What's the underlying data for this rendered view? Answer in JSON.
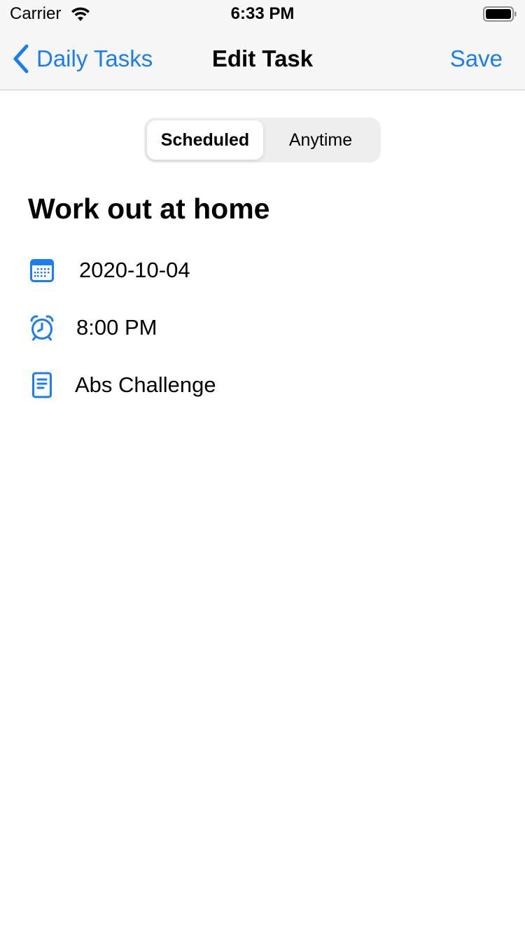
{
  "status_bar": {
    "carrier": "Carrier",
    "time": "6:33 PM",
    "wifi_icon": "wifi-icon",
    "battery_icon": "battery-icon"
  },
  "nav": {
    "back_label": "Daily Tasks",
    "title": "Edit Task",
    "save_label": "Save"
  },
  "segments": {
    "items": [
      "Scheduled",
      "Anytime"
    ],
    "selected": "Scheduled"
  },
  "task": {
    "title": "Work out at home",
    "date": "2020-10-04",
    "time": "8:00 PM",
    "note": "Abs Challenge"
  },
  "colors": {
    "accent": "#1a7ef2",
    "nav_background": "#f7f7f7",
    "segment_background": "#eeeeef"
  }
}
